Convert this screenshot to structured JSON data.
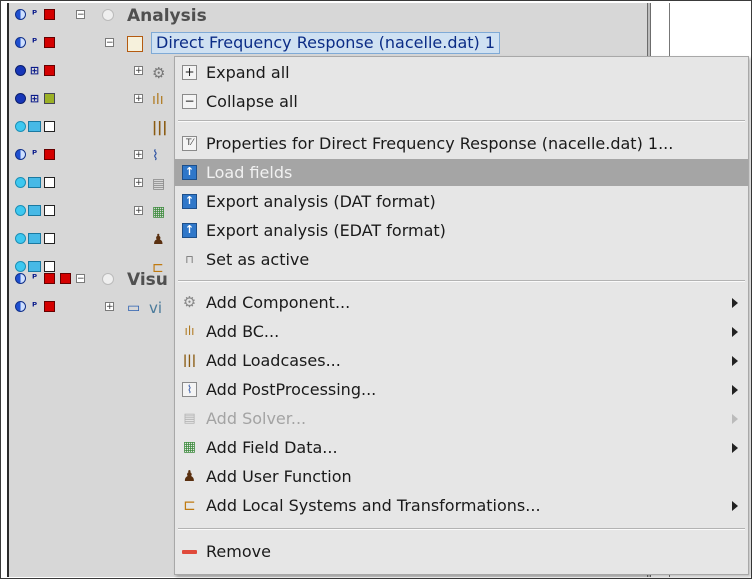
{
  "tree": {
    "analysis_label": "Analysis",
    "selected_item_label": "Direct Frequency Response (nacelle.dat) 1",
    "visu_label": "Visu",
    "vi_label": "vi"
  },
  "context_menu": {
    "items": [
      {
        "label": "Expand all",
        "icon": "plus-box-icon",
        "enabled": true,
        "submenu": false
      },
      {
        "label": "Collapse all",
        "icon": "minus-box-icon",
        "enabled": true,
        "submenu": false
      },
      {
        "label": "Properties for Direct Frequency Response (nacelle.dat) 1...",
        "icon": "properties-icon",
        "enabled": true,
        "submenu": false
      },
      {
        "label": "Load fields",
        "icon": "upload-icon",
        "enabled": true,
        "submenu": false,
        "highlighted": true
      },
      {
        "label": "Export analysis (DAT format)",
        "icon": "upload-icon",
        "enabled": true,
        "submenu": false
      },
      {
        "label": "Export analysis (EDAT format)",
        "icon": "upload-icon",
        "enabled": true,
        "submenu": false
      },
      {
        "label": "Set as active",
        "icon": "pin-icon",
        "enabled": true,
        "submenu": false
      },
      {
        "label": "Add Component...",
        "icon": "gear-icon",
        "enabled": true,
        "submenu": true
      },
      {
        "label": "Add BC...",
        "icon": "bc-icon",
        "enabled": true,
        "submenu": true
      },
      {
        "label": "Add Loadcases...",
        "icon": "loadcase-icon",
        "enabled": true,
        "submenu": true
      },
      {
        "label": "Add PostProcessing...",
        "icon": "postprocessing-icon",
        "enabled": true,
        "submenu": true
      },
      {
        "label": "Add Solver...",
        "icon": "solver-icon",
        "enabled": false,
        "submenu": true
      },
      {
        "label": "Add Field Data...",
        "icon": "field-data-icon",
        "enabled": true,
        "submenu": true
      },
      {
        "label": "Add User Function",
        "icon": "user-icon",
        "enabled": true,
        "submenu": false
      },
      {
        "label": "Add Local Systems and Transformations...",
        "icon": "local-systems-icon",
        "enabled": true,
        "submenu": true
      },
      {
        "label": "Remove",
        "icon": "remove-icon",
        "enabled": true,
        "submenu": false
      }
    ]
  },
  "colors": {
    "highlight": "#a5a5a5",
    "selection_bg": "#cfe1f2",
    "selection_text": "#0b2c86",
    "menu_bg": "#e6e6e6",
    "tree_bg": "#d7d7d7"
  }
}
